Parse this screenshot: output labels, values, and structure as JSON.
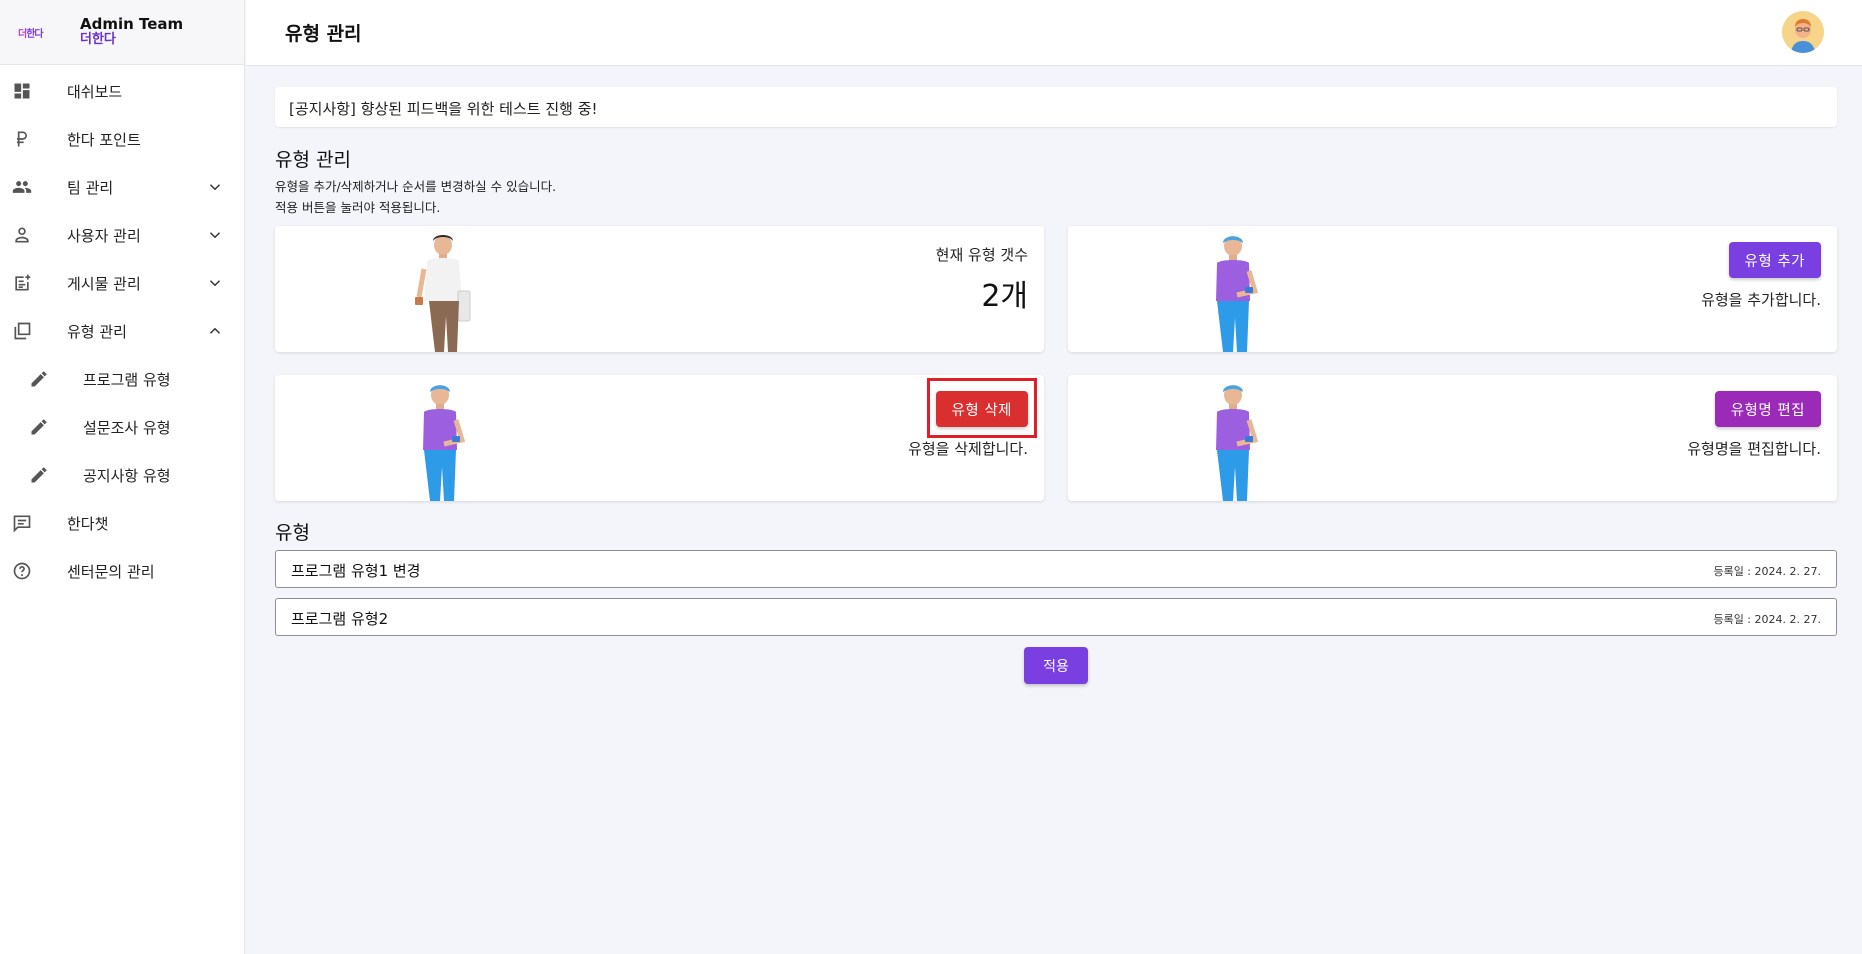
{
  "brand": {
    "logo_text_1": "더",
    "logo_text_2": "한다",
    "title": "Admin Team",
    "subtitle": "더한다"
  },
  "header": {
    "title": "유형 관리"
  },
  "sidebar": {
    "items": [
      {
        "label": "대쉬보드",
        "icon": "dashboard-icon"
      },
      {
        "label": "한다 포인트",
        "icon": "ruble-icon"
      },
      {
        "label": "팀 관리",
        "icon": "people-icon",
        "expanded": false
      },
      {
        "label": "사용자 관리",
        "icon": "person-icon",
        "expanded": false
      },
      {
        "label": "게시물 관리",
        "icon": "post-add-icon",
        "expanded": false
      },
      {
        "label": "유형 관리",
        "icon": "library-icon",
        "expanded": true
      },
      {
        "label": "프로그램 유형",
        "icon": "pencil-icon"
      },
      {
        "label": "설문조사 유형",
        "icon": "pencil-icon"
      },
      {
        "label": "공지사항 유형",
        "icon": "pencil-icon"
      },
      {
        "label": "한다챗",
        "icon": "chat-icon"
      },
      {
        "label": "센터문의 관리",
        "icon": "help-icon"
      }
    ]
  },
  "notice": "[공지사항] 향상된 피드백을 위한 테스트 진행 중!",
  "section": {
    "title": "유형 관리",
    "desc1": "유형을 추가/삭제하거나 순서를 변경하실 수 있습니다.",
    "desc2": "적용 버튼을 눌러야 적용됩니다."
  },
  "cards": {
    "count_label": "현재 유형 갯수",
    "count_value": "2개",
    "add_button": "유형 추가",
    "add_desc": "유형을 추가합니다.",
    "delete_button": "유형 삭제",
    "delete_desc": "유형을 삭제합니다.",
    "edit_button": "유형명 편집",
    "edit_desc": "유형명을 편집합니다."
  },
  "list": {
    "title": "유형",
    "rows": [
      {
        "name": "프로그램 유형1 변경",
        "date": "등록일 : 2024. 2. 27."
      },
      {
        "name": "프로그램 유형2",
        "date": "등록일 : 2024. 2. 27."
      }
    ]
  },
  "apply_button": "적용",
  "colors": {
    "primary": "#7a3fe0",
    "danger": "#d92f2f",
    "edit": "#9b2ab8",
    "highlight": "#e01e2a"
  }
}
